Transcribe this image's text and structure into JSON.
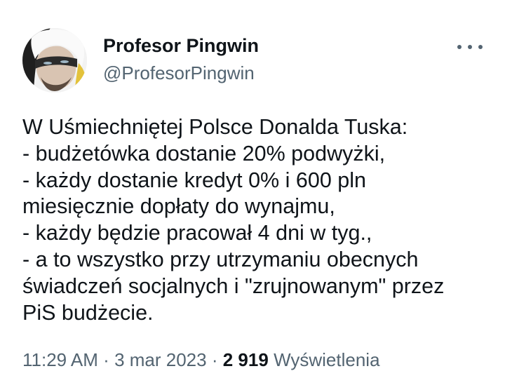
{
  "author": {
    "display_name": "Profesor Pingwin",
    "handle": "@ProfesorPingwin"
  },
  "more_icon": "more-horizontal-icon",
  "tweet": {
    "lines": [
      "W Uśmiechniętej Polsce Donalda Tuska:",
      "- budżetówka dostanie 20% podwyżki,",
      "- każdy dostanie kredyt 0% i 600 pln",
      "miesięcznie dopłaty do wynajmu,",
      "- każdy będzie pracował 4 dni w tyg.,",
      "- a to wszystko przy utrzymaniu obecnych",
      "świadczeń socjalnych i \"zrujnowanym\" przez",
      "PiS budżecie."
    ]
  },
  "meta": {
    "time": "11:29 AM",
    "separator": "·",
    "date": "3 mar 2023",
    "views_count": "2 919",
    "views_label": "Wyświetlenia"
  },
  "colors": {
    "text_primary": "#0f1419",
    "text_secondary": "#536471",
    "background": "#ffffff"
  }
}
